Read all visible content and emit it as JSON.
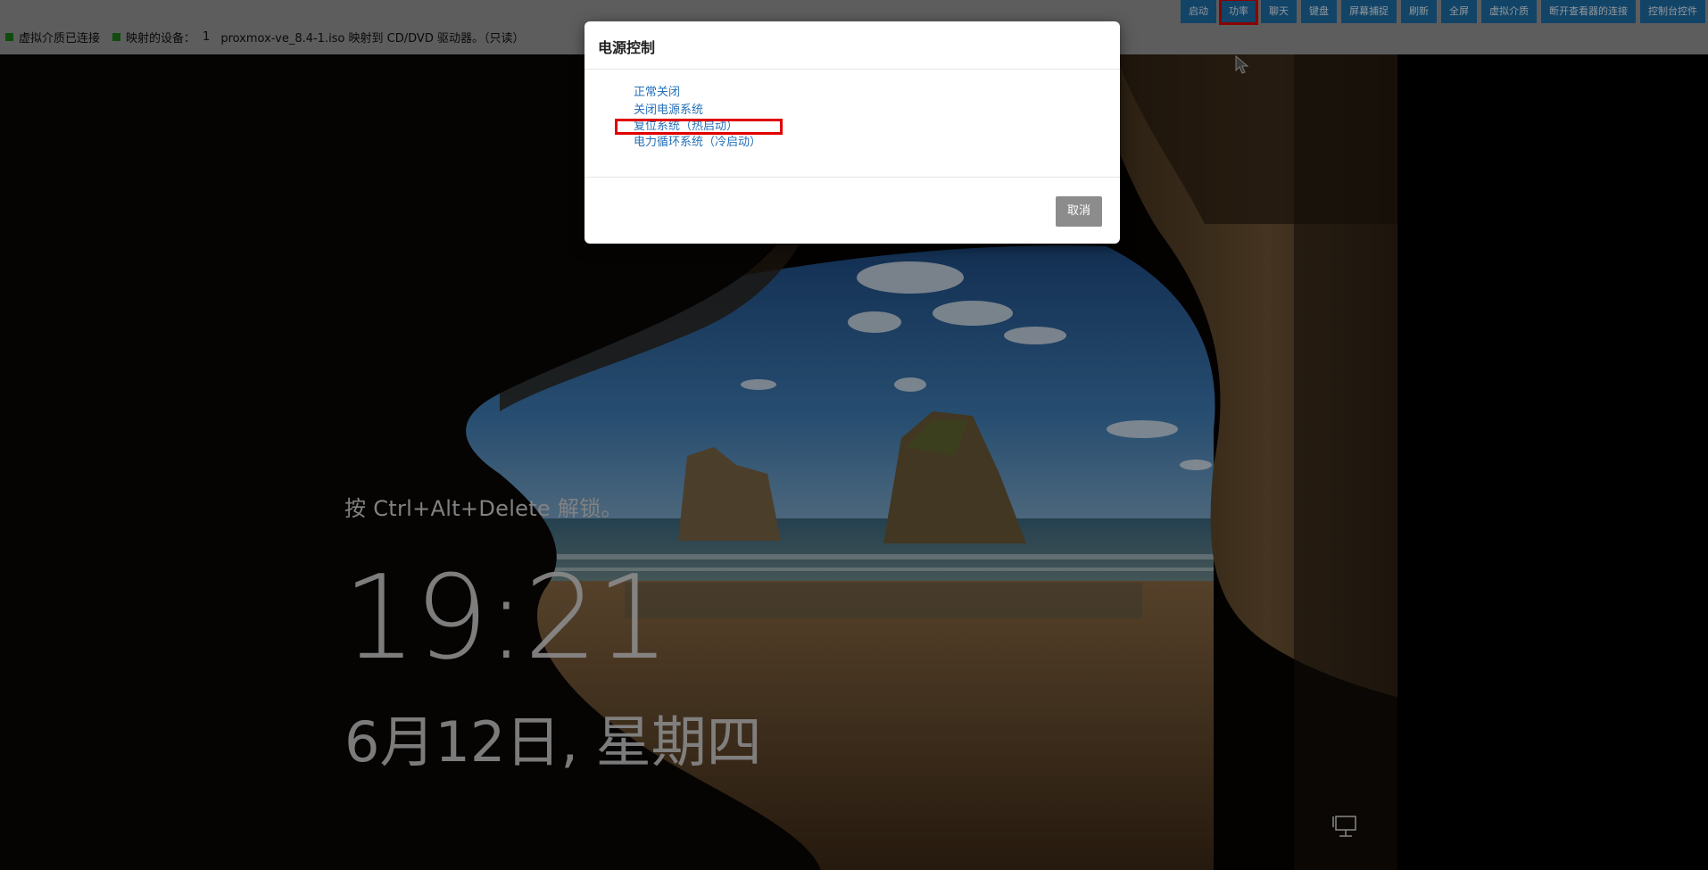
{
  "status": {
    "media_connected": "虚拟介质已连接",
    "mapped_label": "映射的设备：",
    "mapped_count": "1",
    "mapped_detail": "proxmox-ve_8.4-1.iso 映射到 CD/DVD 驱动器。（只读）",
    "indicator_color": "#1b7a1b"
  },
  "toolbar": {
    "buttons": [
      {
        "label": "启动"
      },
      {
        "label": "功率"
      },
      {
        "label": "聊天"
      },
      {
        "label": "键盘"
      },
      {
        "label": "屏幕捕捉"
      },
      {
        "label": "刷新"
      },
      {
        "label": "全屏"
      },
      {
        "label": "虚拟介质"
      },
      {
        "label": "断开查看器的连接"
      },
      {
        "label": "控制台控件"
      }
    ],
    "accent": "#1e6fa6",
    "highlight_color": "#e00000"
  },
  "lockscreen": {
    "unlock_hint": "按 Ctrl+Alt+Delete 解锁。",
    "time": "19:21",
    "date": "6月12日, 星期四"
  },
  "dialog": {
    "title": "电源控制",
    "options": [
      {
        "label": "正常关闭"
      },
      {
        "label": "关闭电源系统"
      },
      {
        "label": "复位系统（热启动）"
      },
      {
        "label": "电力循环系统（冷启动）"
      }
    ],
    "cancel_label": "取消",
    "link_color": "#2470b8"
  },
  "icons": [
    "network-icon",
    "mouse-cursor-icon"
  ]
}
